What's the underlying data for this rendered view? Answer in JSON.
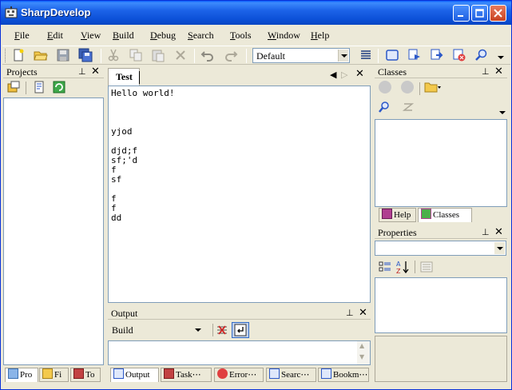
{
  "window": {
    "title": "SharpDevelop"
  },
  "menu": [
    "File",
    "Edit",
    "View",
    "Build",
    "Debug",
    "Search",
    "Tools",
    "Window",
    "Help"
  ],
  "toolbar": {
    "configuration": "Default"
  },
  "projects_pad": {
    "title": "Projects"
  },
  "left_tabs": [
    "Pro",
    "Fi",
    "To"
  ],
  "editor": {
    "tab": "Test",
    "lines": [
      "Hello world!",
      "",
      "",
      "",
      "yjod",
      "",
      "djd;f",
      "sf;'d",
      "f",
      "sf",
      "",
      "f",
      "f",
      "dd"
    ]
  },
  "output_pad": {
    "title": "Output",
    "source": "Build"
  },
  "bottom_tabs": [
    "Output",
    "Task⋯",
    "Error⋯",
    "Searc⋯",
    "Bookm⋯"
  ],
  "classes_pad": {
    "title": "Classes",
    "tabs": [
      "Help",
      "Classes"
    ]
  },
  "properties_pad": {
    "title": "Properties"
  },
  "colors": {
    "titlebar": "#0b4fd6",
    "chrome": "#ece9d8",
    "border": "#7f9db9"
  }
}
